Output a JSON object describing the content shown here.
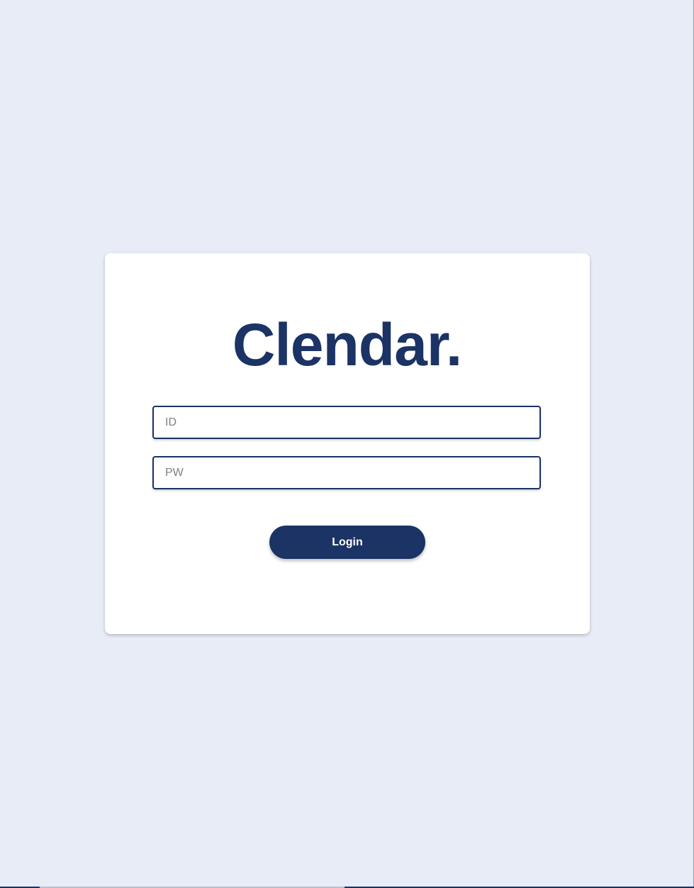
{
  "app": {
    "title": "Clendar."
  },
  "login_form": {
    "id_placeholder": "ID",
    "id_value": "",
    "pw_placeholder": "PW",
    "pw_value": "",
    "login_label": "Login"
  },
  "colors": {
    "background": "#e7ecf6",
    "card": "#ffffff",
    "brand": "#1b3365",
    "button_text": "#ffffff",
    "placeholder": "#808080"
  }
}
